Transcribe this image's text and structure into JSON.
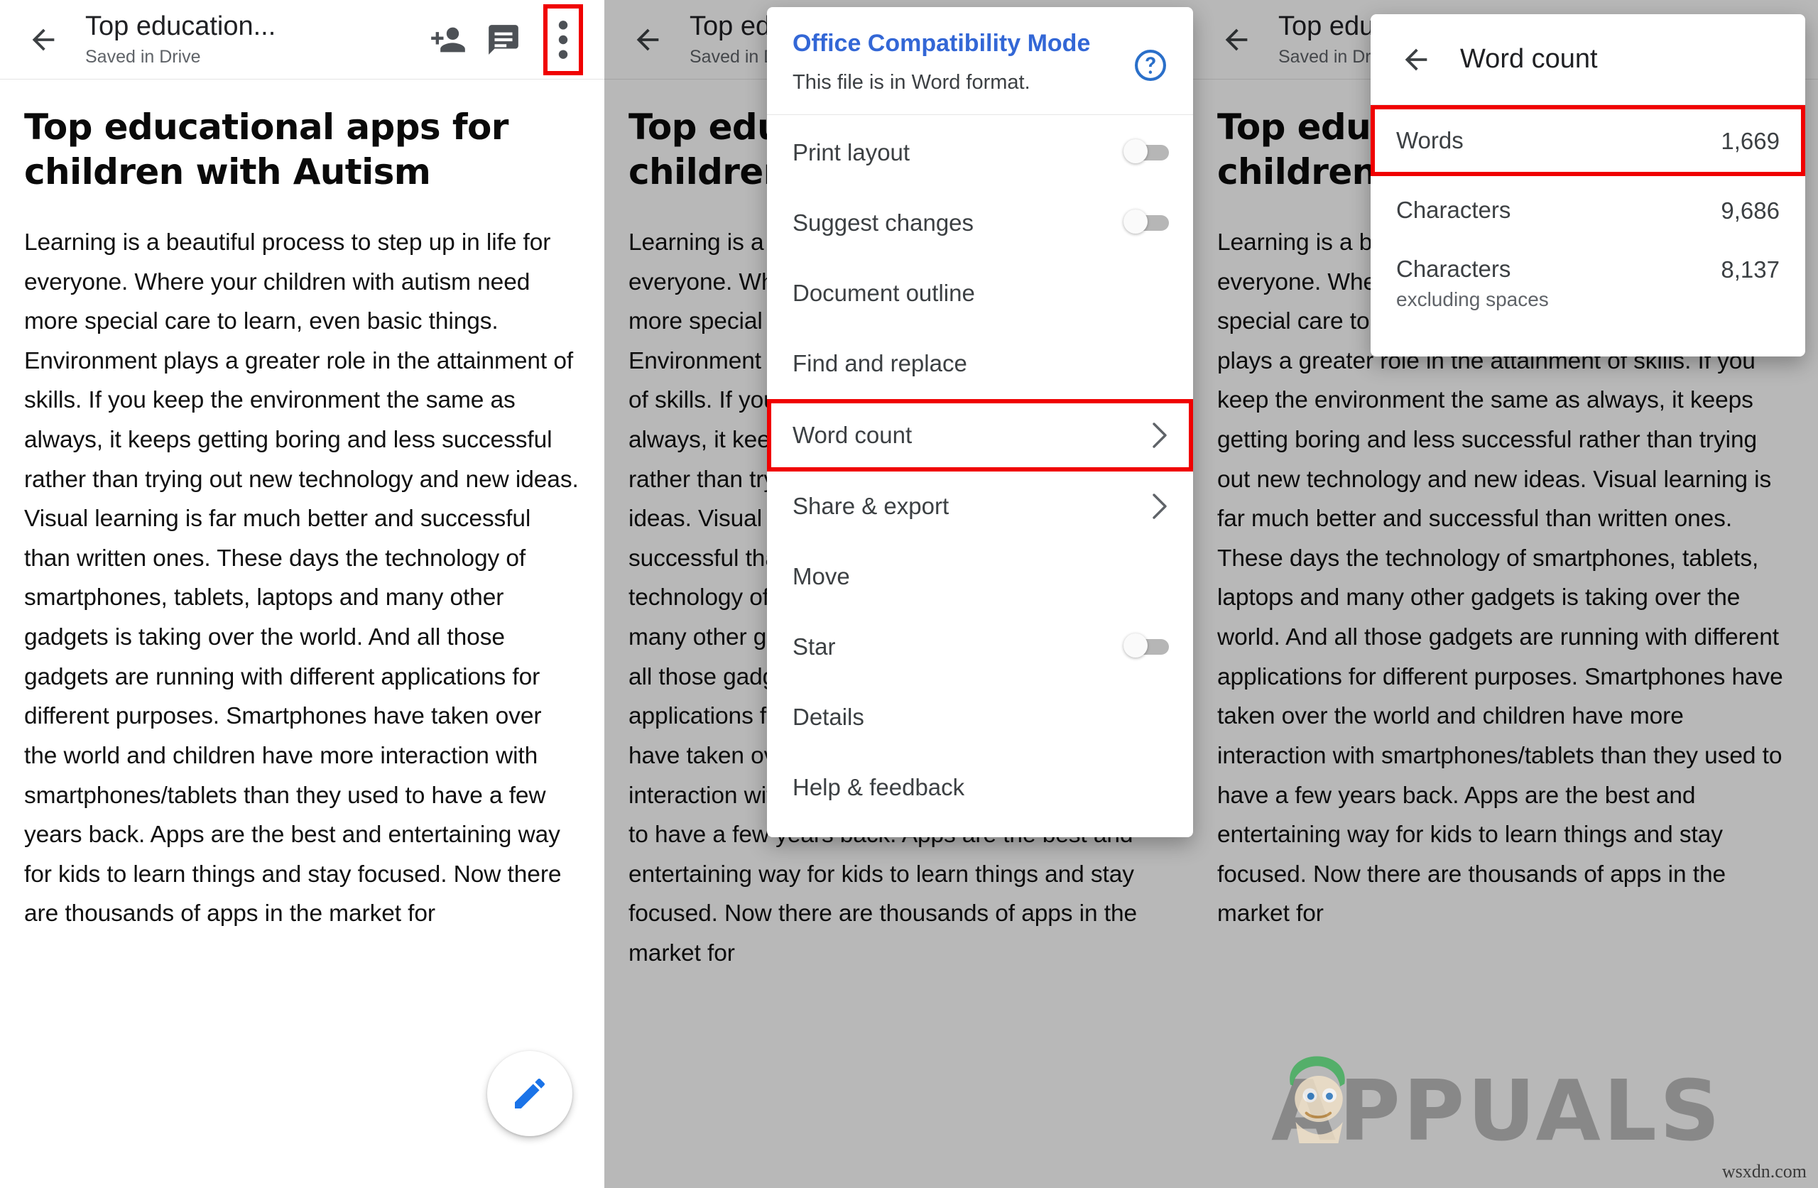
{
  "app": {
    "doc_title": "Top education...",
    "doc_subtitle": "Saved in Drive",
    "back_icon": "back-arrow-icon",
    "add_person_icon": "person-add-icon",
    "comment_icon": "comment-icon",
    "overflow_icon": "more-vert-icon",
    "fab_icon": "edit-pencil-icon",
    "accent_blue": "#1a73e8",
    "highlight_red": "#f00000"
  },
  "document": {
    "heading": "Top educational apps for children with Autism",
    "paragraph": "Learning is a beautiful process to step up in life for everyone. Where your children with autism need more special care to learn, even basic things. Environment plays a greater role in the attainment of skills. If you keep the environment the same as always, it keeps getting boring and less successful rather than trying out new technology and new ideas. Visual learning is far much better and successful than written ones. These days the technology of smartphones, tablets, laptops and many other gadgets is taking over the world. And all those gadgets are running with different applications for different purposes. Smartphones have taken over the world and children have more interaction with smartphones/tablets than they used to have a few years back. Apps are the best and entertaining way for kids to learn things and stay focused. Now there are thousands of apps in the market for"
  },
  "overflow_menu": {
    "banner_title": "Office Compatibility Mode",
    "banner_subtitle": "This file is in Word format.",
    "help_icon": "help-circle-icon",
    "items": [
      {
        "label": "Print layout",
        "type": "toggle",
        "state": "off"
      },
      {
        "label": "Suggest changes",
        "type": "toggle",
        "state": "off"
      },
      {
        "label": "Document outline",
        "type": "plain"
      },
      {
        "label": "Find and replace",
        "type": "plain"
      },
      {
        "label": "Word count",
        "type": "submenu",
        "highlighted": true
      },
      {
        "label": "Share & export",
        "type": "submenu"
      },
      {
        "label": "Move",
        "type": "plain"
      },
      {
        "label": "Star",
        "type": "toggle",
        "state": "off"
      },
      {
        "label": "Details",
        "type": "plain"
      },
      {
        "label": "Help & feedback",
        "type": "plain"
      }
    ]
  },
  "word_count_dialog": {
    "title": "Word count",
    "back_icon": "back-arrow-icon",
    "rows": [
      {
        "label": "Words",
        "sublabel": "",
        "value": "1,669",
        "highlighted": true
      },
      {
        "label": "Characters",
        "sublabel": "",
        "value": "9,686"
      },
      {
        "label": "Characters",
        "sublabel": "excluding spaces",
        "value": "8,137"
      }
    ]
  },
  "watermark": {
    "brand": "APPUALS",
    "site_tag": "wsxdn.com"
  }
}
